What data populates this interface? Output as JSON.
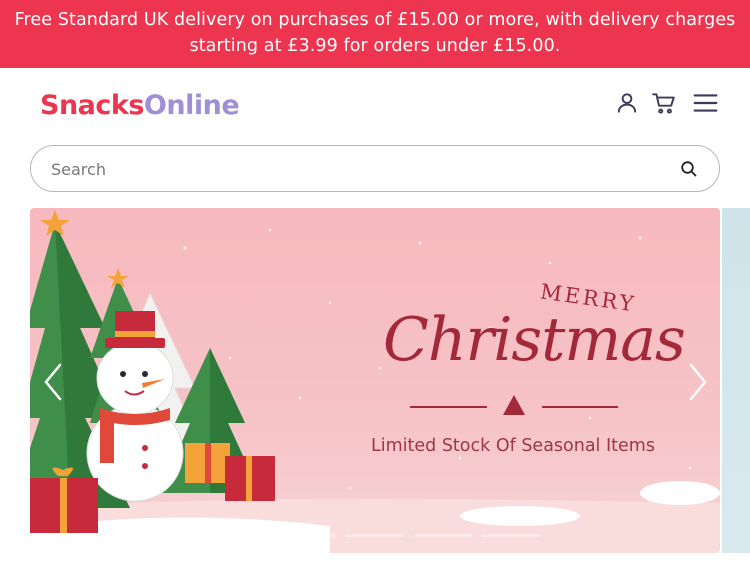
{
  "promo": {
    "line1": "Free Standard UK delivery on purchases of £15.00 or more, with delivery charges",
    "line2": "starting at £3.99 for orders under £15.00."
  },
  "header": {
    "logo_part1": "Snacks",
    "logo_part2": "Online",
    "icons": [
      "account-icon",
      "cart-icon",
      "menu-icon"
    ]
  },
  "search": {
    "placeholder": "Search",
    "value": ""
  },
  "hero": {
    "merry": "MERRY",
    "title": "Christmas",
    "subtitle": "Limited Stock Of Seasonal Items",
    "slide_count": 5,
    "active_slide": 1
  },
  "colors": {
    "brand_red": "#ee3550",
    "brand_purple": "#9d8fd8",
    "hero_text": "#a3283a"
  }
}
